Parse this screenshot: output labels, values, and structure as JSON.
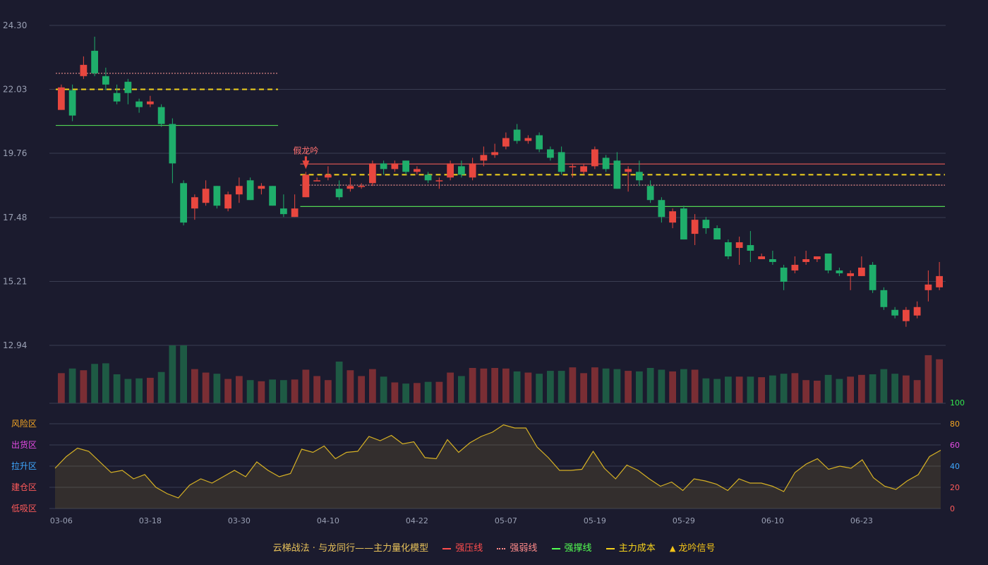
{
  "chart_data": {
    "type": "candlestick",
    "price_axis": {
      "ticks": [
        "24.30",
        "22.03",
        "19.76",
        "17.48",
        "15.21",
        "12.94"
      ],
      "range": [
        12.94,
        24.3
      ]
    },
    "date_ticks": [
      {
        "index": 0,
        "label": "03-06"
      },
      {
        "index": 8,
        "label": "03-18"
      },
      {
        "index": 16,
        "label": "03-30"
      },
      {
        "index": 24,
        "label": "04-10"
      },
      {
        "index": 32,
        "label": "04-22"
      },
      {
        "index": 40,
        "label": "05-07"
      },
      {
        "index": 48,
        "label": "05-19"
      },
      {
        "index": 56,
        "label": "05-29"
      },
      {
        "index": 64,
        "label": "06-10"
      },
      {
        "index": 72,
        "label": "06-23"
      }
    ],
    "candles": [
      [
        21.3,
        22.1,
        22.2,
        21.3
      ],
      [
        22.0,
        21.1,
        22.2,
        20.9
      ],
      [
        22.5,
        22.9,
        23.2,
        22.4
      ],
      [
        23.4,
        22.6,
        23.9,
        22.5
      ],
      [
        22.5,
        22.2,
        22.8,
        22.0
      ],
      [
        21.9,
        21.6,
        22.2,
        21.5
      ],
      [
        22.3,
        21.9,
        22.4,
        21.5
      ],
      [
        21.6,
        21.4,
        21.7,
        21.2
      ],
      [
        21.5,
        21.6,
        21.8,
        21.4
      ],
      [
        21.4,
        20.8,
        21.5,
        20.7
      ],
      [
        20.8,
        19.4,
        21.0,
        18.7
      ],
      [
        18.7,
        17.3,
        18.8,
        17.2
      ],
      [
        17.8,
        18.2,
        18.3,
        17.4
      ],
      [
        18.0,
        18.5,
        18.8,
        17.9
      ],
      [
        18.6,
        17.9,
        18.6,
        17.8
      ],
      [
        17.8,
        18.3,
        18.4,
        17.7
      ],
      [
        18.3,
        18.6,
        18.9,
        18.0
      ],
      [
        18.8,
        18.1,
        18.9,
        18.1
      ],
      [
        18.5,
        18.6,
        18.7,
        18.3
      ],
      [
        18.6,
        17.9,
        18.6,
        17.9
      ],
      [
        17.8,
        17.6,
        18.3,
        17.5
      ],
      [
        17.5,
        17.8,
        18.3,
        17.5
      ],
      [
        18.2,
        19.0,
        19.1,
        18.2
      ],
      [
        18.8,
        18.8,
        18.9,
        18.8
      ],
      [
        18.9,
        19.0,
        19.3,
        18.8
      ],
      [
        18.5,
        18.2,
        18.8,
        18.1
      ],
      [
        18.5,
        18.6,
        18.9,
        18.4
      ],
      [
        18.6,
        18.6,
        18.7,
        18.5
      ],
      [
        18.7,
        19.4,
        19.5,
        18.6
      ],
      [
        19.4,
        19.2,
        19.5,
        19.0
      ],
      [
        19.2,
        19.4,
        19.5,
        19.1
      ],
      [
        19.5,
        19.1,
        19.5,
        19.0
      ],
      [
        19.1,
        19.2,
        19.3,
        19.0
      ],
      [
        19.0,
        18.8,
        19.1,
        18.7
      ],
      [
        18.8,
        18.8,
        18.9,
        18.5
      ],
      [
        18.9,
        19.4,
        19.5,
        18.8
      ],
      [
        19.3,
        19.0,
        19.5,
        18.9
      ],
      [
        18.9,
        19.4,
        19.6,
        18.8
      ],
      [
        19.5,
        19.7,
        20.0,
        19.3
      ],
      [
        19.7,
        19.8,
        20.1,
        19.6
      ],
      [
        20.0,
        20.3,
        20.5,
        19.9
      ],
      [
        20.6,
        20.2,
        20.8,
        20.1
      ],
      [
        20.2,
        20.3,
        20.4,
        20.1
      ],
      [
        20.4,
        19.9,
        20.5,
        19.8
      ],
      [
        19.9,
        19.6,
        20.0,
        19.5
      ],
      [
        19.8,
        19.1,
        20.0,
        19.0
      ],
      [
        19.3,
        19.3,
        19.4,
        18.9
      ],
      [
        19.1,
        19.3,
        19.4,
        19.0
      ],
      [
        19.3,
        19.9,
        20.0,
        19.2
      ],
      [
        19.6,
        19.2,
        19.7,
        19.1
      ],
      [
        19.5,
        18.5,
        19.8,
        18.5
      ],
      [
        19.1,
        19.2,
        19.3,
        18.4
      ],
      [
        19.1,
        18.8,
        19.5,
        18.6
      ],
      [
        18.6,
        18.1,
        18.8,
        18.0
      ],
      [
        18.1,
        17.5,
        18.2,
        17.3
      ],
      [
        17.3,
        17.7,
        17.8,
        17.1
      ],
      [
        17.8,
        16.7,
        17.9,
        16.7
      ],
      [
        16.9,
        17.4,
        17.6,
        16.5
      ],
      [
        17.4,
        17.1,
        17.5,
        16.9
      ],
      [
        17.1,
        16.7,
        17.2,
        16.7
      ],
      [
        16.6,
        16.1,
        16.7,
        16.0
      ],
      [
        16.4,
        16.6,
        16.8,
        15.8
      ],
      [
        16.5,
        16.3,
        17.0,
        15.9
      ],
      [
        16.0,
        16.1,
        16.2,
        16.0
      ],
      [
        16.0,
        15.9,
        16.3,
        15.8
      ],
      [
        15.7,
        15.2,
        15.8,
        14.9
      ],
      [
        15.6,
        15.8,
        16.1,
        15.5
      ],
      [
        15.9,
        16.0,
        16.3,
        15.8
      ],
      [
        16.0,
        16.1,
        16.1,
        15.9
      ],
      [
        16.2,
        15.6,
        16.2,
        15.5
      ],
      [
        15.6,
        15.5,
        15.7,
        15.4
      ],
      [
        15.4,
        15.5,
        15.6,
        14.9
      ],
      [
        15.4,
        15.7,
        16.1,
        15.4
      ],
      [
        15.8,
        14.9,
        15.9,
        14.8
      ],
      [
        14.9,
        14.3,
        15.0,
        14.2
      ],
      [
        14.2,
        14.0,
        14.3,
        13.9
      ],
      [
        13.8,
        14.2,
        14.3,
        13.6
      ],
      [
        14.0,
        14.3,
        14.5,
        13.9
      ],
      [
        14.9,
        15.1,
        15.6,
        14.5
      ],
      [
        15.0,
        15.4,
        15.9,
        14.9
      ]
    ],
    "volume_colors": "same-as-candle",
    "volumes": [
      52,
      60,
      57,
      68,
      69,
      50,
      42,
      43,
      44,
      54,
      100,
      100,
      59,
      53,
      51,
      42,
      47,
      40,
      38,
      41,
      40,
      41,
      58,
      47,
      40,
      72,
      57,
      47,
      59,
      46,
      36,
      34,
      35,
      37,
      37,
      53,
      47,
      61,
      60,
      61,
      60,
      55,
      53,
      51,
      56,
      56,
      62,
      52,
      62,
      60,
      59,
      56,
      55,
      61,
      58,
      55,
      59,
      58,
      43,
      42,
      46,
      46,
      46,
      45,
      48,
      51,
      52,
      40,
      39,
      49,
      42,
      46,
      49,
      50,
      59,
      51,
      48,
      40,
      83,
      76
    ],
    "volume_max": 100,
    "model_line_start_values": [],
    "indicator": {
      "zones": [
        "风险区",
        "出货区",
        "拉升区",
        "建仓区",
        "低吸区"
      ],
      "ticks": [
        "100",
        "80",
        "60",
        "40",
        "20",
        "0"
      ],
      "range": [
        0,
        100
      ],
      "values": [
        38,
        49,
        57,
        54,
        44,
        34,
        36,
        28,
        32,
        20,
        14,
        10,
        22,
        28,
        24,
        30,
        36,
        30,
        44,
        36,
        30,
        33,
        56,
        53,
        59,
        47,
        53,
        54,
        68,
        64,
        69,
        61,
        63,
        48,
        47,
        65,
        53,
        62,
        68,
        72,
        79,
        76,
        76,
        58,
        48,
        36,
        36,
        37,
        54,
        38,
        28,
        41,
        36,
        28,
        21,
        25,
        17,
        28,
        26,
        23,
        17,
        28,
        24,
        24,
        21,
        16,
        34,
        42,
        47,
        37,
        40,
        38,
        46,
        29,
        21,
        18,
        26,
        32,
        49,
        55
      ],
      "zone_colors": [
        "#f5a623",
        "#e64ce6",
        "#3fa8ff",
        "#ff5a5a",
        "#ff5a5a"
      ],
      "tick_colors": [
        "#33e64d",
        "#f5a623",
        "#e64ce6",
        "#3fa8ff",
        "#ff5a5a",
        "#ff5a5a"
      ]
    },
    "levels": [
      {
        "kind": "强压线",
        "from": 22,
        "to": 80,
        "value": 19.38,
        "color": "#e85b55",
        "style": "solid"
      },
      {
        "kind": "强弱线",
        "from": 0,
        "to": 20,
        "value": 22.6,
        "color": "#e88b8b",
        "style": "dot"
      },
      {
        "kind": "强弱线",
        "from": 22,
        "to": 80,
        "value": 18.63,
        "color": "#e88b8b",
        "style": "dot"
      },
      {
        "kind": "强撑线",
        "from": 0,
        "to": 20,
        "value": 20.75,
        "color": "#52d452",
        "style": "solid"
      },
      {
        "kind": "强撑线",
        "from": 22,
        "to": 80,
        "value": 17.87,
        "color": "#52d452",
        "style": "solid"
      },
      {
        "kind": "主力成本",
        "from": 0,
        "to": 20,
        "value": 22.03,
        "color": "#f2d21c",
        "style": "dash"
      },
      {
        "kind": "主力成本",
        "from": 22,
        "to": 80,
        "value": 19.0,
        "color": "#f2d21c",
        "style": "dash"
      }
    ],
    "signal": {
      "index": 22,
      "label": "假龙吟"
    },
    "colors": {
      "up": "#e8473f",
      "down": "#1fae6b",
      "up_volume": "#7a2e34",
      "down_volume": "#1e5a44",
      "grid": "#3a3d52",
      "axis_text": "#9aa0b4",
      "indicator_line": "#d6b124"
    }
  },
  "legend": {
    "model_title": "云梯战法 · 与龙同行——主力量化模型",
    "items": [
      {
        "label": "强压线",
        "color": "#ff4d4d",
        "style": "solid"
      },
      {
        "label": "强弱线",
        "color": "#ff8a8a",
        "style": "dot"
      },
      {
        "label": "强撑线",
        "color": "#52ff52",
        "style": "solid"
      },
      {
        "label": "主力成本",
        "color": "#f5d21c",
        "style": "dash"
      }
    ],
    "signal_label": "龙吟信号",
    "signal_color": "#f5c518"
  }
}
